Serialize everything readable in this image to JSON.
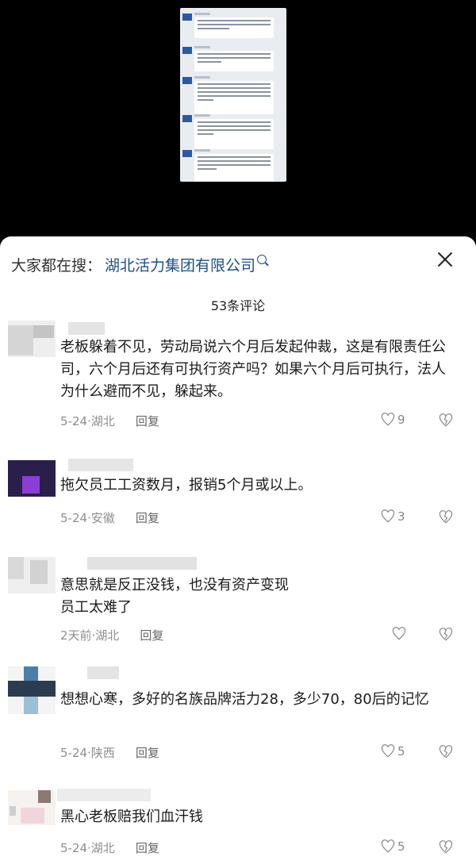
{
  "search": {
    "prefix": "大家都在搜：",
    "term": "湖北活力集团有限公司"
  },
  "comment_count": "53条评论",
  "comments": [
    {
      "text": "老板躲着不见，劳动局说六个月后发起仲裁，这是有限责任公司，六个月后还有可执行资产吗？如果六个月后可执行，法人为什么避而不见，躲起来。",
      "time_location": "5-24·湖北",
      "reply_label": "回复",
      "likes": "9"
    },
    {
      "text": "拖欠员工工资数月，报销5个月或以上。",
      "time_location": "5-24·安徽",
      "reply_label": "回复",
      "likes": "3"
    },
    {
      "text_lines": [
        "意思就是反正没钱，也没有资产变现",
        "员工太难了"
      ],
      "time_location": "2天前·湖北",
      "reply_label": "回复",
      "likes": ""
    },
    {
      "text": "想想心寒，多好的名族品牌活力28，多少70，80后的记忆",
      "time_location": "5-24·陕西",
      "reply_label": "回复",
      "likes": "5"
    },
    {
      "text": "黑心老板赔我们血汗钱",
      "time_location": "5-24·湖北",
      "reply_label": "回复",
      "likes": "5"
    }
  ],
  "colors": {
    "search_term": "#1d4f86",
    "text": "#1b1b1b",
    "meta": "#8e8e8e"
  }
}
